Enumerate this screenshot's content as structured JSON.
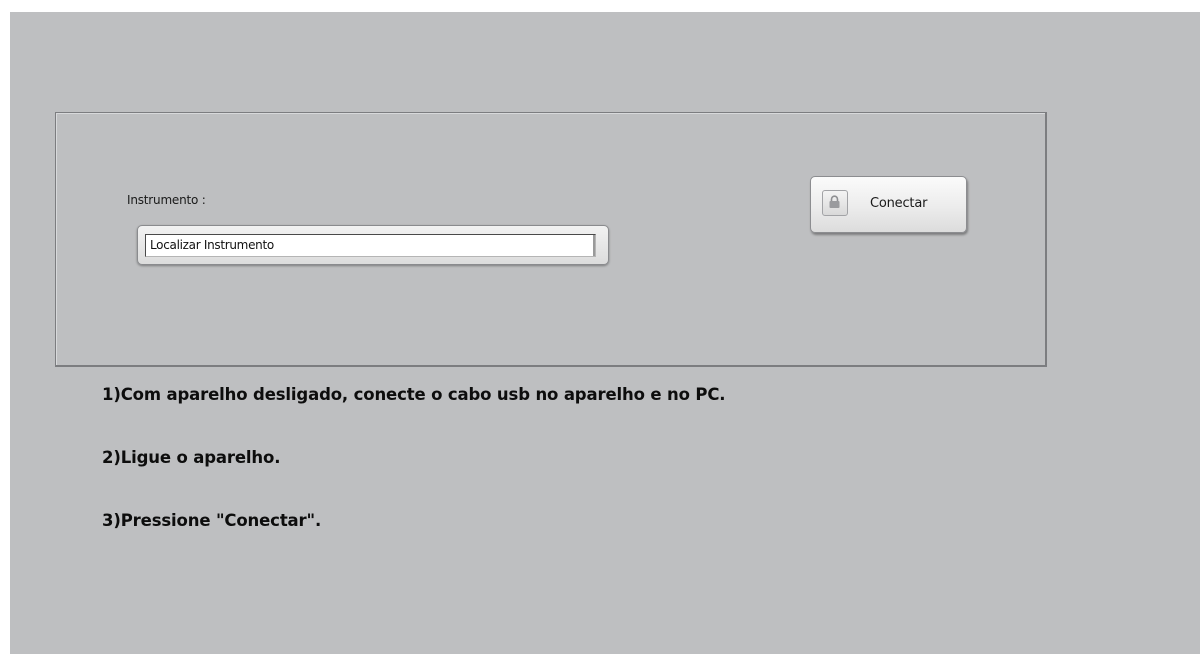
{
  "instrument": {
    "label": "Instrumento :",
    "value": "Localizar Instrumento"
  },
  "connect_button": {
    "label": "Conectar",
    "icon": "lock-icon"
  },
  "instructions": [
    "1)Com aparelho desligado, conecte o cabo usb no aparelho e no PC.",
    "2)Ligue o aparelho.",
    "3)Pressione \"Conectar\"."
  ],
  "colors": {
    "background": "#bebfc1",
    "panel_border": "#7c7d80",
    "text": "#0d0d0d"
  }
}
